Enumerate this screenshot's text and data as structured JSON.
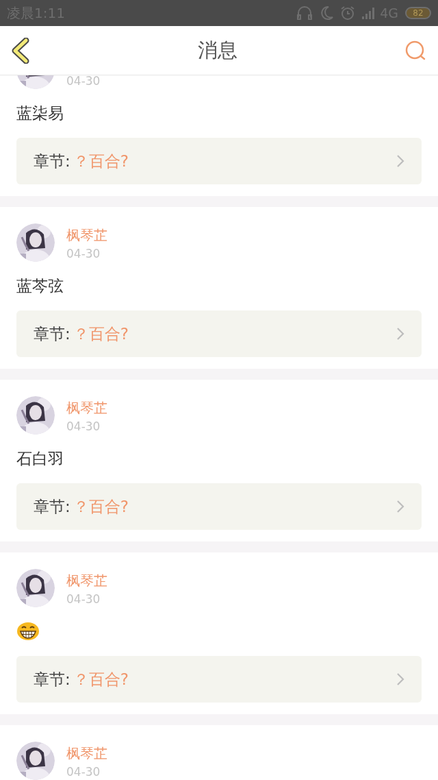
{
  "status_bar": {
    "time": "凌晨1:11",
    "network": "4G",
    "battery": "82"
  },
  "header": {
    "title": "消息"
  },
  "messages": [
    {
      "date": "04-30",
      "content": {
        "kind": "text",
        "text": "蓝柒易"
      },
      "chapter": {
        "label": "章节:",
        "title": "？百合?"
      }
    },
    {
      "name": "枫琴芷",
      "date": "04-30",
      "content": {
        "kind": "text",
        "text": "蓝芩弦"
      },
      "chapter": {
        "label": "章节:",
        "title": "？百合?"
      }
    },
    {
      "name": "枫琴芷",
      "date": "04-30",
      "content": {
        "kind": "text",
        "text": "石白羽"
      },
      "chapter": {
        "label": "章节:",
        "title": "？百合?"
      }
    },
    {
      "name": "枫琴芷",
      "date": "04-30",
      "content": {
        "kind": "emoji"
      },
      "chapter": {
        "label": "章节:",
        "title": "？百合?"
      }
    },
    {
      "name": "枫琴芷",
      "date": "04-30"
    }
  ]
}
